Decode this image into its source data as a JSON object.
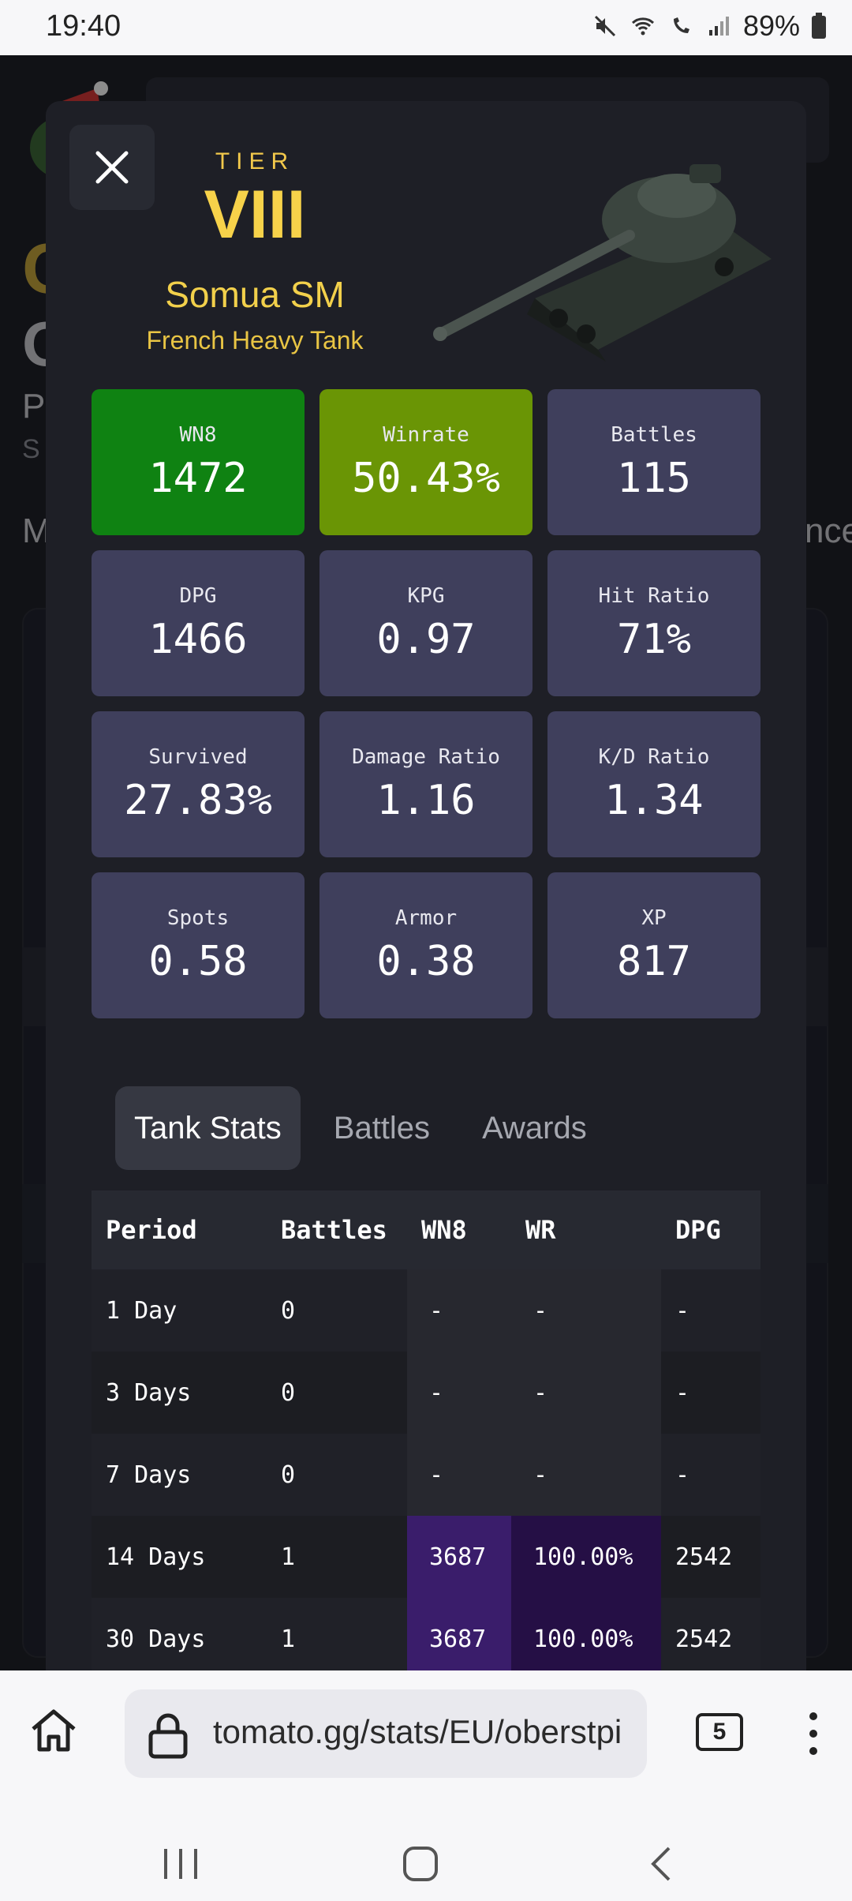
{
  "status_bar": {
    "time": "19:40",
    "battery": "89%"
  },
  "tank": {
    "tier_label": "TIER",
    "tier": "VIII",
    "name": "Somua SM",
    "class": "French Heavy Tank"
  },
  "colors": {
    "wn8_card": "#0f8212",
    "winrate_card": "#6a9505",
    "default_card": "#3f3f5c",
    "purple_cell": "#3a1d6b",
    "dark_purple_cell": "#250f45"
  },
  "stats": [
    {
      "label": "WN8",
      "value": "1472",
      "color": "#0f8212"
    },
    {
      "label": "Winrate",
      "value": "50.43%",
      "color": "#6a9505"
    },
    {
      "label": "Battles",
      "value": "115"
    },
    {
      "label": "DPG",
      "value": "1466"
    },
    {
      "label": "KPG",
      "value": "0.97"
    },
    {
      "label": "Hit Ratio",
      "value": "71%"
    },
    {
      "label": "Survived",
      "value": "27.83%"
    },
    {
      "label": "Damage Ratio",
      "value": "1.16"
    },
    {
      "label": "K/D Ratio",
      "value": "1.34"
    },
    {
      "label": "Spots",
      "value": "0.58"
    },
    {
      "label": "Armor",
      "value": "0.38"
    },
    {
      "label": "XP",
      "value": "817"
    }
  ],
  "tabs": [
    "Tank Stats",
    "Battles",
    "Awards"
  ],
  "table": {
    "headers": [
      "Period",
      "Battles",
      "WN8",
      "WR",
      "DPG"
    ],
    "rows": [
      [
        "1 Day",
        "0",
        "-",
        "-",
        "-"
      ],
      [
        "3 Days",
        "0",
        "-",
        "-",
        "-"
      ],
      [
        "7 Days",
        "0",
        "-",
        "-",
        "-"
      ],
      [
        "14 Days",
        "1",
        "3687",
        "100.00%",
        "2542"
      ],
      [
        "30 Days",
        "1",
        "3687",
        "100.00%",
        "2542"
      ]
    ]
  },
  "browser": {
    "url": "tomato.gg/stats/EU/oberstpi",
    "tab_count": "5"
  }
}
